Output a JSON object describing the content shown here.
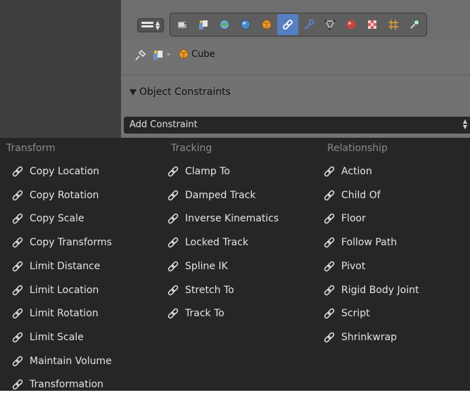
{
  "header": {
    "editor_type_icon": "properties-editor-icon",
    "tabs": [
      {
        "name": "render",
        "icon": "camera-icon"
      },
      {
        "name": "render-layers",
        "icon": "render-layers-icon"
      },
      {
        "name": "scene",
        "icon": "scene-icon"
      },
      {
        "name": "world",
        "icon": "world-icon"
      },
      {
        "name": "object",
        "icon": "object-icon"
      },
      {
        "name": "constraints",
        "icon": "constraint-link-icon",
        "active": true
      },
      {
        "name": "modifiers",
        "icon": "wrench-icon"
      },
      {
        "name": "data",
        "icon": "mesh-data-icon"
      },
      {
        "name": "material",
        "icon": "material-icon"
      },
      {
        "name": "texture",
        "icon": "texture-icon"
      },
      {
        "name": "particles",
        "icon": "particles-icon"
      },
      {
        "name": "physics",
        "icon": "physics-icon"
      }
    ]
  },
  "breadcrumb": {
    "object_label": "Cube"
  },
  "panel": {
    "title": "Object Constraints",
    "add_constraint_label": "Add Constraint"
  },
  "menu": {
    "columns": [
      {
        "heading": "Transform",
        "items": [
          "Copy Location",
          "Copy Rotation",
          "Copy Scale",
          "Copy Transforms",
          "Limit Distance",
          "Limit Location",
          "Limit Rotation",
          "Limit Scale",
          "Maintain Volume",
          "Transformation"
        ]
      },
      {
        "heading": "Tracking",
        "items": [
          "Clamp To",
          "Damped Track",
          "Inverse Kinematics",
          "Locked Track",
          "Spline IK",
          "Stretch To",
          "Track To"
        ]
      },
      {
        "heading": "Relationship",
        "items": [
          "Action",
          "Child Of",
          "Floor",
          "Follow Path",
          "Pivot",
          "Rigid Body Joint",
          "Script",
          "Shrinkwrap"
        ]
      }
    ]
  },
  "colors": {
    "menu_bg": "#262626",
    "panel_bg": "#727272",
    "active_tab": "#5680c2",
    "menu_text": "#e4e4e4",
    "heading_text": "#8c8c8c"
  }
}
